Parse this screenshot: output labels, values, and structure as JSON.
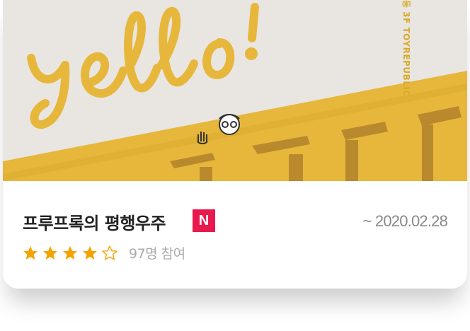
{
  "poster": {
    "headline": "yello!",
    "side_text": "동 3F TOYREPUBLIC",
    "colors": {
      "background": "#e9e6e1",
      "accent": "#e7b73c",
      "shadow": "#c49433"
    }
  },
  "event": {
    "title": "프루프록의 평행우주",
    "badge": "N",
    "date": "~ 2020.02.28",
    "rating": 4,
    "rating_max": 5,
    "participants": "97명 참여"
  },
  "icons": {
    "star_filled": "star-filled-icon",
    "star_empty": "star-outline-icon",
    "badge_color": "#e8194e",
    "star_color": "#f5a300"
  }
}
